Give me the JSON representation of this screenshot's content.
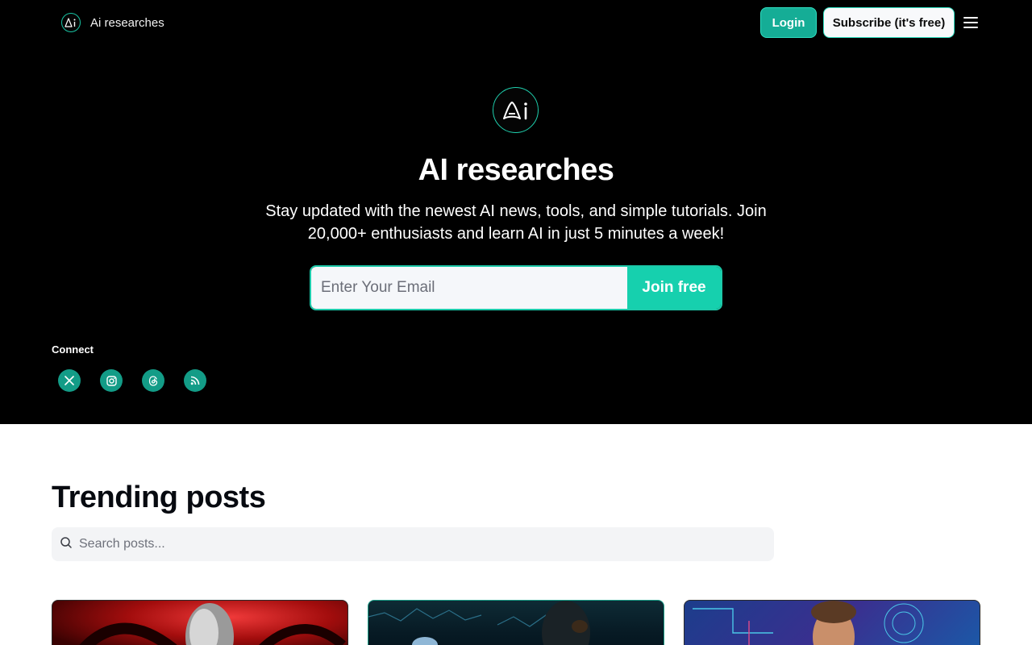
{
  "nav": {
    "brand": "Ai researches",
    "login_label": "Login",
    "subscribe_label": "Subscribe (it's free)"
  },
  "hero": {
    "title": "AI researches",
    "subtitle": "Stay updated with the newest AI news, tools, and simple tutorials. Join 20,000+ enthusiasts and learn AI in just 5 minutes a week!",
    "email_placeholder": "Enter Your Email",
    "join_label": "Join free"
  },
  "connect": {
    "label": "Connect",
    "icons": [
      "x-icon",
      "instagram-icon",
      "threads-icon",
      "rss-icon"
    ]
  },
  "trending": {
    "title": "Trending posts",
    "search_placeholder": "Search posts..."
  },
  "colors": {
    "accent": "#16d0ae",
    "accent_dark": "#139c87",
    "hero_bg": "#000000"
  }
}
